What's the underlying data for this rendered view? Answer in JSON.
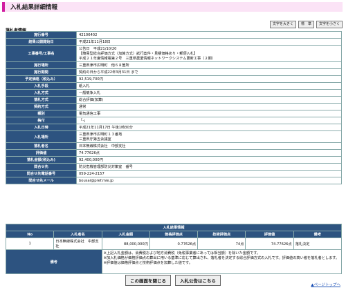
{
  "page_title": "入札結果詳細情報",
  "font_buttons": [
    "文字を大きく",
    "標　準",
    "文字を小さく"
  ],
  "section_label": "落札者情報",
  "info_rows": [
    {
      "label": "施行番号",
      "lines": [
        "42106402"
      ]
    },
    {
      "label": "結果公開開始日",
      "lines": [
        "平成21年11月18日"
      ]
    },
    {
      "label": "工事番号/工事名",
      "lines": [
        "公告日　平成21/10/20",
        "【簡易型総合評価方式（加算方式）試行案件・見積価格あり・郵便入札】",
        "平成２１年度情報電第２号　三重県農業情報ネットワークシステム更新工事（２期）"
      ]
    },
    {
      "label": "施行場所",
      "lines": [
        "三重県津市広明町　他６８箇所"
      ]
    },
    {
      "label": "施行期間",
      "lines": [
        "契約の日から平成22年3月31日 まで"
      ]
    },
    {
      "label": "予定価格（税込み）",
      "lines": [
        "92,519,700円"
      ]
    },
    {
      "label": "入札手段",
      "lines": [
        "紙入札"
      ]
    },
    {
      "label": "入札方式",
      "lines": [
        "一般競争入札"
      ]
    },
    {
      "label": "落札方式",
      "lines": [
        "総合評価(加算)"
      ]
    },
    {
      "label": "契約方式",
      "lines": [
        "通常"
      ]
    },
    {
      "label": "種別",
      "lines": [
        "電気通信工事"
      ]
    },
    {
      "label": "格付",
      "lines": [
        "「-」"
      ]
    },
    {
      "label": "入札日時",
      "lines": [
        "平成21年11月17日 午後1時30分"
      ]
    },
    {
      "label": "入札場所",
      "lines": [
        "三重県津市広明町１３番地",
        "三重県庁第五会議室"
      ]
    },
    {
      "label": "落札者名",
      "lines": [
        "日本無線株式会社　中部支社"
      ]
    },
    {
      "label": "評価値",
      "lines": [
        "74.77626点"
      ]
    },
    {
      "label": "落札金額(税込み)",
      "lines": [
        "92,400,000円"
      ]
    },
    {
      "label": "問合せ先",
      "lines": [
        "防災危機管理部防災対策室　番号"
      ]
    },
    {
      "label": "問合せ先電話番号",
      "lines": [
        "059-224-2157"
      ]
    },
    {
      "label": "問合せ先メール",
      "lines": [
        "bousai@pref.mie.jp"
      ]
    }
  ],
  "result": {
    "header": "入札結果情報",
    "columns": [
      "No",
      "入札者名",
      "入札金額",
      "価格評価点",
      "技術評価点",
      "評価値",
      "備考"
    ],
    "rows": [
      {
        "no": "1",
        "name": "日本無線株式会社　中部支社",
        "amount": "88,000,000円",
        "price_score": "0.77626点",
        "tech_score": "74点",
        "value": "74.77626点",
        "note": "落札決定"
      }
    ],
    "remarks_label": "備考",
    "remarks_lines": [
      "※上記入札金額は、消費税および地方消費税（免税事業者にあっては相当額）を除いた金額です。",
      "※加入札価格が価格評価点の算出に用いる基準に応じて算出され、落札者を決定する総合評価方式の入札です。評価値の高い者を落札者とします。",
      "※評価値は価格評価点と技術評価点を加算した値です。"
    ]
  },
  "buttons": [
    "この画面を閉じる",
    "入札公告はこちら"
  ],
  "top_link": "▲ページトップへ"
}
